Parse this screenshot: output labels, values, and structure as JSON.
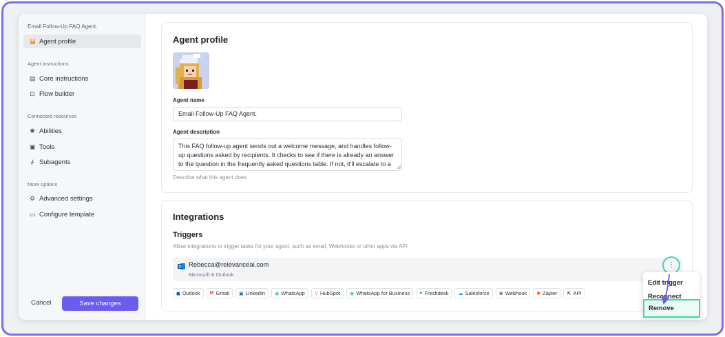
{
  "sidebar": {
    "header": "Email Follow-Up FAQ Agent.",
    "agent_profile": "Agent profile",
    "sections": {
      "instructions": "Agent instructions",
      "resources": "Connected resources",
      "more": "More options"
    },
    "items": {
      "core_instructions": "Core instructions",
      "flow_builder": "Flow builder",
      "abilities": "Abilities",
      "tools": "Tools",
      "subagents": "Subagents",
      "advanced_settings": "Advanced settings",
      "configure_template": "Configure template"
    },
    "cancel": "Cancel",
    "save": "Save changes"
  },
  "profile": {
    "title": "Agent profile",
    "name_label": "Agent name",
    "name_value": "Email Follow-Up FAQ Agent.",
    "desc_label": "Agent description",
    "desc_value": "This FAQ follow-up agent sends out a welcome message, and handles follow-up questions asked by recipients. It checks to see if there is already an answer to the question in the frequently asked questions table. If not, it'll escalate to a team member before answering.",
    "desc_hint": "Describe what this agent does"
  },
  "integrations": {
    "title": "Integrations",
    "triggers_title": "Triggers",
    "triggers_hint": "Allow integrations to trigger tasks for your agent, such as email, Webhooks or other apps via API",
    "trigger": {
      "email": "Rebecca@relevanceai.com",
      "provider": "Microsoft & Outlook"
    },
    "chips": [
      "Outlook",
      "Gmail",
      "LinkedIn",
      "WhatsApp",
      "HubSpot",
      "WhatsApp for Business",
      "Freshdesk",
      "Salesforce",
      "Webhook",
      "Zapier",
      "API"
    ]
  },
  "menu": {
    "edit": "Edit trigger",
    "reconnect": "Reconnect",
    "remove": "Remove"
  },
  "colors": {
    "accent": "#6b5cf0",
    "highlight": "#3fd6b1",
    "frame": "#7b6cf0"
  }
}
